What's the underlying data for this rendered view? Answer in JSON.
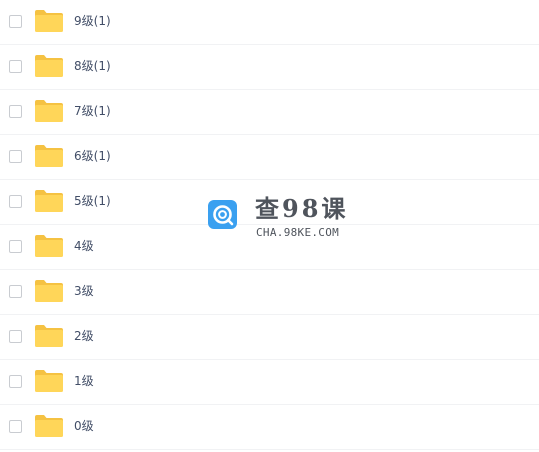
{
  "files": [
    {
      "name": "9级(1)"
    },
    {
      "name": "8级(1)"
    },
    {
      "name": "7级(1)"
    },
    {
      "name": "6级(1)"
    },
    {
      "name": "5级(1)"
    },
    {
      "name": "4级"
    },
    {
      "name": "3级"
    },
    {
      "name": "2级"
    },
    {
      "name": "1级"
    },
    {
      "name": "0级"
    }
  ],
  "watermark": {
    "title": "查98课",
    "url": "CHA.98KE.COM"
  },
  "colors": {
    "folder": "#ffd659",
    "folder_tab": "#f5c242",
    "text": "#424e67",
    "logo": "#3aa0f0"
  },
  "icons": {
    "checkbox": "checkbox-icon",
    "folder": "folder-icon",
    "logo": "cha98ke-logo-icon"
  }
}
